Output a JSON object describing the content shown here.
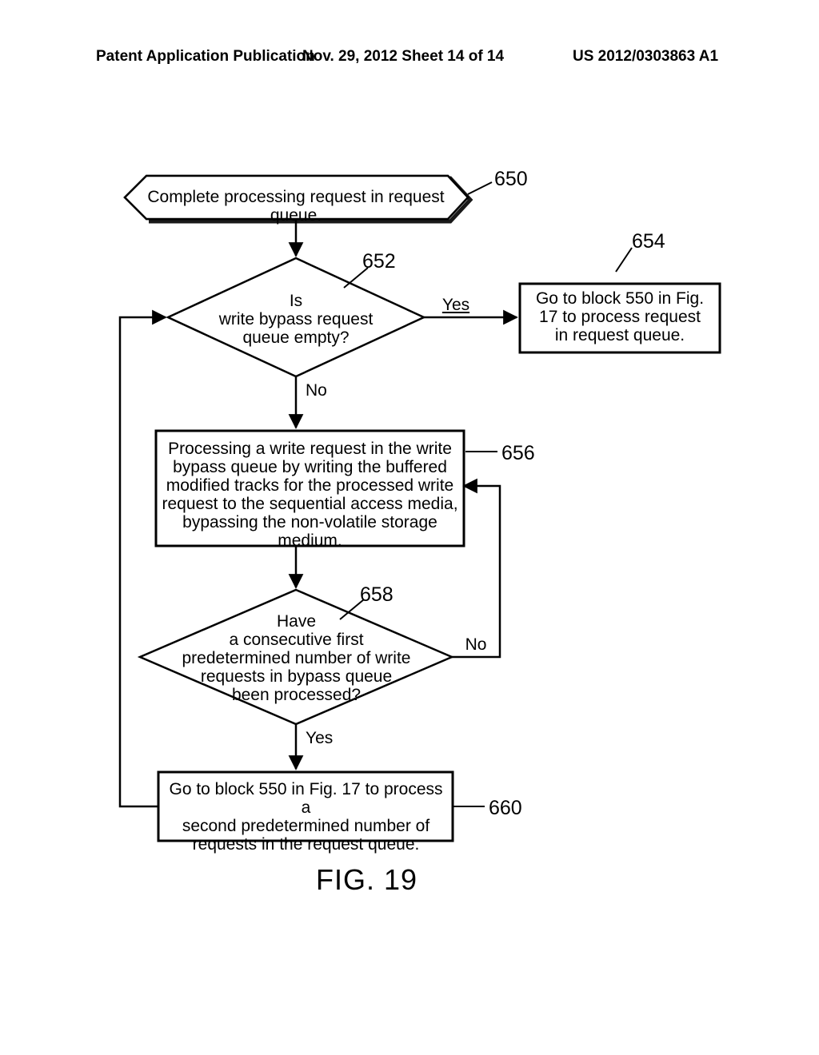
{
  "header": {
    "left": "Patent Application Publication",
    "center": "Nov. 29, 2012  Sheet 14 of 14",
    "right": "US 2012/0303863 A1"
  },
  "nodes": {
    "start": "Complete processing request in request queue.",
    "decision1": "Is\nwrite bypass request\nqueue empty?",
    "box654": "Go to block 550 in Fig.\n17 to process request\nin request queue.",
    "box656": "Processing a write request in the write\nbypass queue by writing the buffered\nmodified tracks for the processed write\nrequest to the sequential access media,\nbypassing the non-volatile storage medium.",
    "decision2": "Have\na consecutive first\npredetermined number of write\nrequests in bypass queue\nbeen processed?",
    "box660": "Go to block 550 in Fig. 17 to process a\nsecond predetermined number of\nrequests in the request queue."
  },
  "edges": {
    "yes": "Yes",
    "no": "No"
  },
  "refs": {
    "r650": "650",
    "r652": "652",
    "r654": "654",
    "r656": "656",
    "r658": "658",
    "r660": "660"
  },
  "figure": "FIG. 19"
}
